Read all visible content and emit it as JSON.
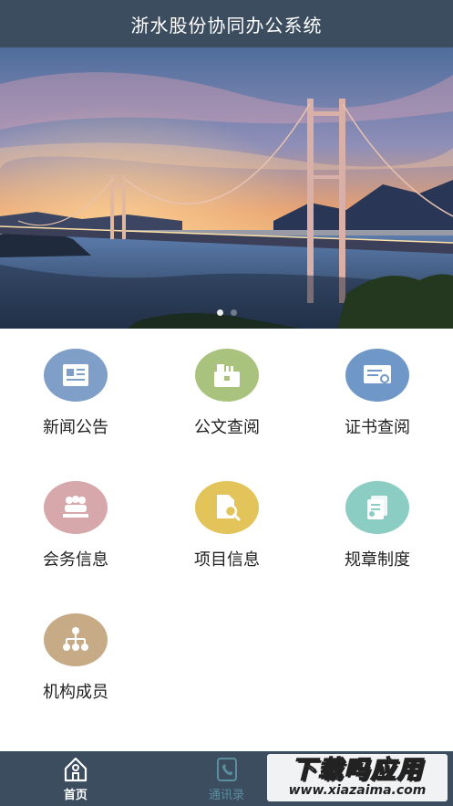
{
  "header": {
    "title": "浙水股份协同办公系统"
  },
  "banner": {
    "slides": 2,
    "active_slide": 1,
    "image": "suspension-bridge-at-sunset"
  },
  "modules": [
    {
      "label": "新闻公告",
      "icon": "newspaper-icon",
      "color": "#7f9ec8"
    },
    {
      "label": "公文查阅",
      "icon": "briefcase-icon",
      "color": "#a9c37e"
    },
    {
      "label": "证书查阅",
      "icon": "certificate-icon",
      "color": "#6f97c7"
    },
    {
      "label": "会务信息",
      "icon": "meeting-icon",
      "color": "#d6a8ac"
    },
    {
      "label": "项目信息",
      "icon": "document-search-icon",
      "color": "#e2c45a"
    },
    {
      "label": "规章制度",
      "icon": "rules-icon",
      "color": "#8ccdc3"
    },
    {
      "label": "机构成员",
      "icon": "org-chart-icon",
      "color": "#c6ab86"
    }
  ],
  "tabbar": {
    "items": [
      {
        "label": "首页",
        "icon": "home-icon",
        "active": true
      },
      {
        "label": "通讯录",
        "icon": "contacts-icon",
        "active": false
      }
    ]
  },
  "watermark": {
    "title": "下载吗应用",
    "url": "www.xiazaima.com"
  }
}
